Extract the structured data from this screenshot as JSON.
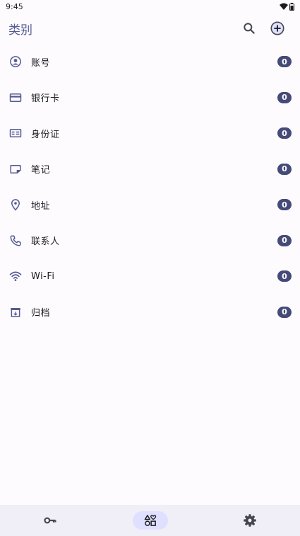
{
  "status_bar": {
    "time": "9:45"
  },
  "appbar": {
    "title": "类别",
    "actions": [
      {
        "icon": "search-icon"
      },
      {
        "icon": "add-circle-icon"
      }
    ]
  },
  "categories": [
    {
      "icon": "account-icon",
      "label": "账号",
      "count": "0"
    },
    {
      "icon": "credit-card-icon",
      "label": "银行卡",
      "count": "0"
    },
    {
      "icon": "id-card-icon",
      "label": "身份证",
      "count": "0"
    },
    {
      "icon": "note-icon",
      "label": "笔记",
      "count": "0"
    },
    {
      "icon": "location-icon",
      "label": "地址",
      "count": "0"
    },
    {
      "icon": "phone-icon",
      "label": "联系人",
      "count": "0"
    },
    {
      "icon": "wifi-icon",
      "label": "Wi-Fi",
      "count": "0"
    },
    {
      "icon": "archive-icon",
      "label": "归档",
      "count": "0"
    }
  ],
  "bottom_nav": [
    {
      "icon": "key-icon",
      "active": false
    },
    {
      "icon": "categories-icon",
      "active": true
    },
    {
      "icon": "settings-icon",
      "active": false
    }
  ],
  "colors": {
    "accent": "#545a92",
    "badge": "#454a78",
    "nav_active": "#dfe0ff",
    "background": "#fefbff"
  }
}
